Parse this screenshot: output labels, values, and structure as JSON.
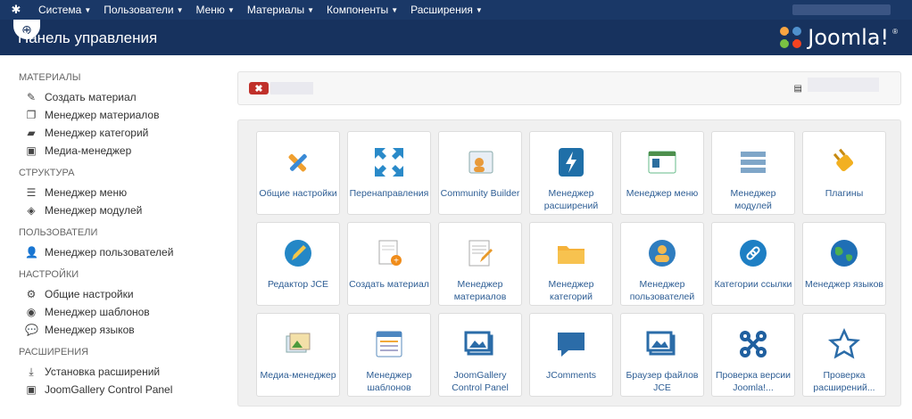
{
  "topnav": {
    "items": [
      "Система",
      "Пользователи",
      "Меню",
      "Материалы",
      "Компоненты",
      "Расширения"
    ]
  },
  "header": {
    "title": "Панель управления",
    "brand": "Joomla!",
    "brand_mark": "®"
  },
  "sidebar": {
    "sections": [
      {
        "title": "МАТЕРИАЛЫ",
        "items": [
          {
            "label": "Создать материал",
            "icon": "pencil-icon"
          },
          {
            "label": "Менеджер материалов",
            "icon": "copy-icon"
          },
          {
            "label": "Менеджер категорий",
            "icon": "folder-icon"
          },
          {
            "label": "Медиа-менеджер",
            "icon": "image-icon"
          }
        ]
      },
      {
        "title": "СТРУКТУРА",
        "items": [
          {
            "label": "Менеджер меню",
            "icon": "list-icon"
          },
          {
            "label": "Менеджер модулей",
            "icon": "cube-icon"
          }
        ]
      },
      {
        "title": "ПОЛЬЗОВАТЕЛИ",
        "items": [
          {
            "label": "Менеджер пользователей",
            "icon": "users-icon"
          }
        ]
      },
      {
        "title": "НАСТРОЙКИ",
        "items": [
          {
            "label": "Общие настройки",
            "icon": "cog-icon"
          },
          {
            "label": "Менеджер шаблонов",
            "icon": "eye-icon"
          },
          {
            "label": "Менеджер языков",
            "icon": "comments-icon"
          }
        ]
      },
      {
        "title": "РАСШИРЕНИЯ",
        "items": [
          {
            "label": "Установка расширений",
            "icon": "download-icon"
          },
          {
            "label": "JoomGallery Control Panel",
            "icon": "image-icon"
          }
        ]
      }
    ]
  },
  "alert": {
    "close_label": "✖"
  },
  "tiles": [
    {
      "label": "Общие настройки",
      "icon": "tools-icon"
    },
    {
      "label": "Перенаправления",
      "icon": "arrows-icon"
    },
    {
      "label": "Community Builder",
      "icon": "community-icon"
    },
    {
      "label": "Менеджер расширений",
      "icon": "flash-icon"
    },
    {
      "label": "Менеджер меню",
      "icon": "menu-window-icon"
    },
    {
      "label": "Менеджер модулей",
      "icon": "modules-icon"
    },
    {
      "label": "Плагины",
      "icon": "plug-icon"
    },
    {
      "label": "Редактор JCE",
      "icon": "jce-pencil-icon"
    },
    {
      "label": "Создать материал",
      "icon": "new-document-icon"
    },
    {
      "label": "Менеджер материалов",
      "icon": "article-edit-icon"
    },
    {
      "label": "Менеджер категорий",
      "icon": "folder-open-icon"
    },
    {
      "label": "Менеджер пользователей",
      "icon": "user-group-icon"
    },
    {
      "label": "Категории ссылки",
      "icon": "link-icon"
    },
    {
      "label": "Менеджер языков",
      "icon": "globe-icon"
    },
    {
      "label": "Медиа-менеджер",
      "icon": "photos-icon"
    },
    {
      "label": "Менеджер шаблонов",
      "icon": "template-icon"
    },
    {
      "label": "JoomGallery Control Panel",
      "icon": "gallery-picture-icon"
    },
    {
      "label": "JComments",
      "icon": "speech-bubble-icon"
    },
    {
      "label": "Браузер файлов JCE",
      "icon": "file-browser-icon"
    },
    {
      "label": "Проверка версии Joomla!...",
      "icon": "joomla-logo-icon"
    },
    {
      "label": "Проверка расширений...",
      "icon": "star-icon"
    }
  ],
  "colors": {
    "topbar": "#1a3867",
    "header": "#17325e",
    "link": "#2d5d94",
    "alert_red": "#c0302a"
  }
}
